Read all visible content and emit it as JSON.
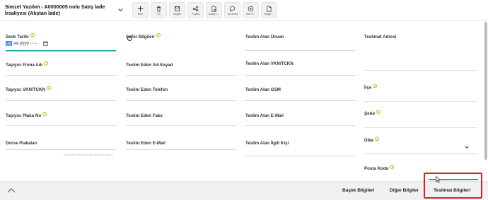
{
  "header": {
    "title": "Simzet Yazılım - A0000005 nolu Satış İade İrsaliyesi (Alıştan İade)",
    "toolbar": [
      {
        "label": "Ekle",
        "icon": "plus-icon"
      },
      {
        "label": "Sil",
        "icon": "trash-icon"
      },
      {
        "label": "Kaydet",
        "icon": "save-icon"
      },
      {
        "label": "Paylaş",
        "icon": "share-icon"
      },
      {
        "label": "Belge İ...",
        "icon": "document-settings-icon"
      },
      {
        "label": "Yorumlar",
        "icon": "comment-icon"
      },
      {
        "label": "Kdv H...",
        "icon": "calculator-icon"
      },
      {
        "label": "Belge ...",
        "icon": "file-icon"
      }
    ]
  },
  "fields": {
    "sevk_tarihi": "Sevk Tarihi",
    "sevk_tarihi_value_sel": "gg",
    "sevk_tarihi_value_rest": ".aa.yyyy --:--",
    "sofor_bilgileri": "Şoför Bilgileri",
    "teslim_alan_unvan": "Teslim Alan Ünvan",
    "teslimat_adresi": "Teslimat Adresi",
    "tasiyici_firma_adi": "Taşıyıcı Firma Adı",
    "teslim_eden_ad_soyad": "Teslim Eden Ad-Soyad",
    "teslim_alan_vkn_tckn": "Teslim Alan VKN/TCKN",
    "tasiyici_vkn_tckn": "Taşıyıcı VKN/TCKN",
    "teslim_eden_telefon": "Teslim Eden Telefon",
    "teslim_alan_gsm": "Teslim Alan GSM",
    "ilce": "İlçe",
    "tasiyici_plaka_no": "Taşıyıcı Plaka No",
    "teslim_eden_faks": "Teslim Eden Faks",
    "teslim_alan_email": "Teslim Alan E-Mail",
    "sehir": "Şehir",
    "dorse_plakalari": "Dorse Plakaları",
    "teslim_eden_email": "Teslim Eden E-Mail",
    "teslim_alan_ilgili_kisi": "Teslim Alan İlgili Kişi",
    "ulke": "Ülke",
    "posta_kodu": "Posta Kodu",
    "hint_text": "Her Dörtlük Tamamlandığı Gibi Enter'a Basın"
  },
  "footer": {
    "tabs": [
      "Başlık Bilgileri",
      "Diğer Bilgiler",
      "Teslimat Bilgileri"
    ],
    "active_tab": "Teslimat Bilgileri"
  },
  "colors": {
    "accent": "#1aa7a7",
    "highlight": "#e02020",
    "info": "#d4b100"
  }
}
